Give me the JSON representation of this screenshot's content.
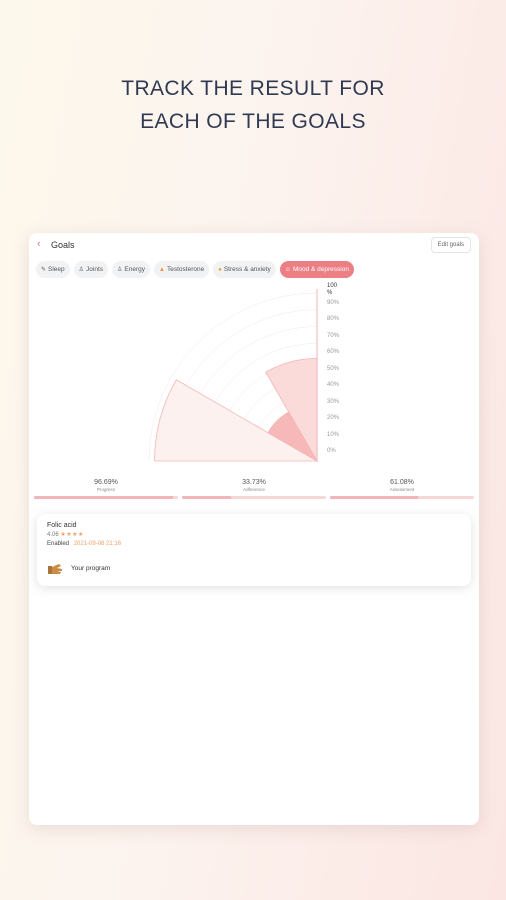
{
  "headline": {
    "line1": "TRACK THE RESULT FOR",
    "line2": "EACH OF THE GOALS"
  },
  "header": {
    "back_icon": "chevron-left-icon",
    "title": "Goals",
    "edit_label": "Edit goals"
  },
  "tabs": [
    {
      "label": "Sleep",
      "icon": "pencil-icon",
      "active": false
    },
    {
      "label": "Joints",
      "icon": "person-icon",
      "active": false
    },
    {
      "label": "Energy",
      "icon": "person-icon",
      "active": false
    },
    {
      "label": "Testosterone",
      "icon": "flame-icon",
      "active": false
    },
    {
      "label": "Stress & anxiety",
      "icon": "smile-icon",
      "active": false
    },
    {
      "label": "Mood & depression",
      "icon": "mood-icon",
      "active": true
    }
  ],
  "chart_data": {
    "type": "polar-area",
    "y_ticks": [
      "100 %",
      "90%",
      "80%",
      "70%",
      "60%",
      "50%",
      "40%",
      "30%",
      "20%",
      "10%",
      "0%"
    ],
    "sectors": [
      {
        "label": "Progress",
        "value": 96.69
      },
      {
        "label": "Adherence",
        "value": 33.73
      },
      {
        "label": "Assessment",
        "value": 61.08
      }
    ],
    "colors": {
      "outer": "#fdf1f0",
      "mid": "#fbdada",
      "inner": "#f7b8b9",
      "stroke": "#f4b7b4"
    }
  },
  "metrics": [
    {
      "value": "96.69%",
      "label": "Progress",
      "fraction": 0.9669
    },
    {
      "value": "33.73%",
      "label": "Adherence",
      "fraction": 0.3373
    },
    {
      "value": "61.08%",
      "label": "Assessment",
      "fraction": 0.6108
    }
  ],
  "program": {
    "name": "Folic acid",
    "rating": "4.06",
    "stars": "★★★★",
    "enabled_label": "Enabled",
    "enabled_date": "2021-09-08 21:16",
    "link_label": "Your program",
    "icon": "hand-icon"
  }
}
